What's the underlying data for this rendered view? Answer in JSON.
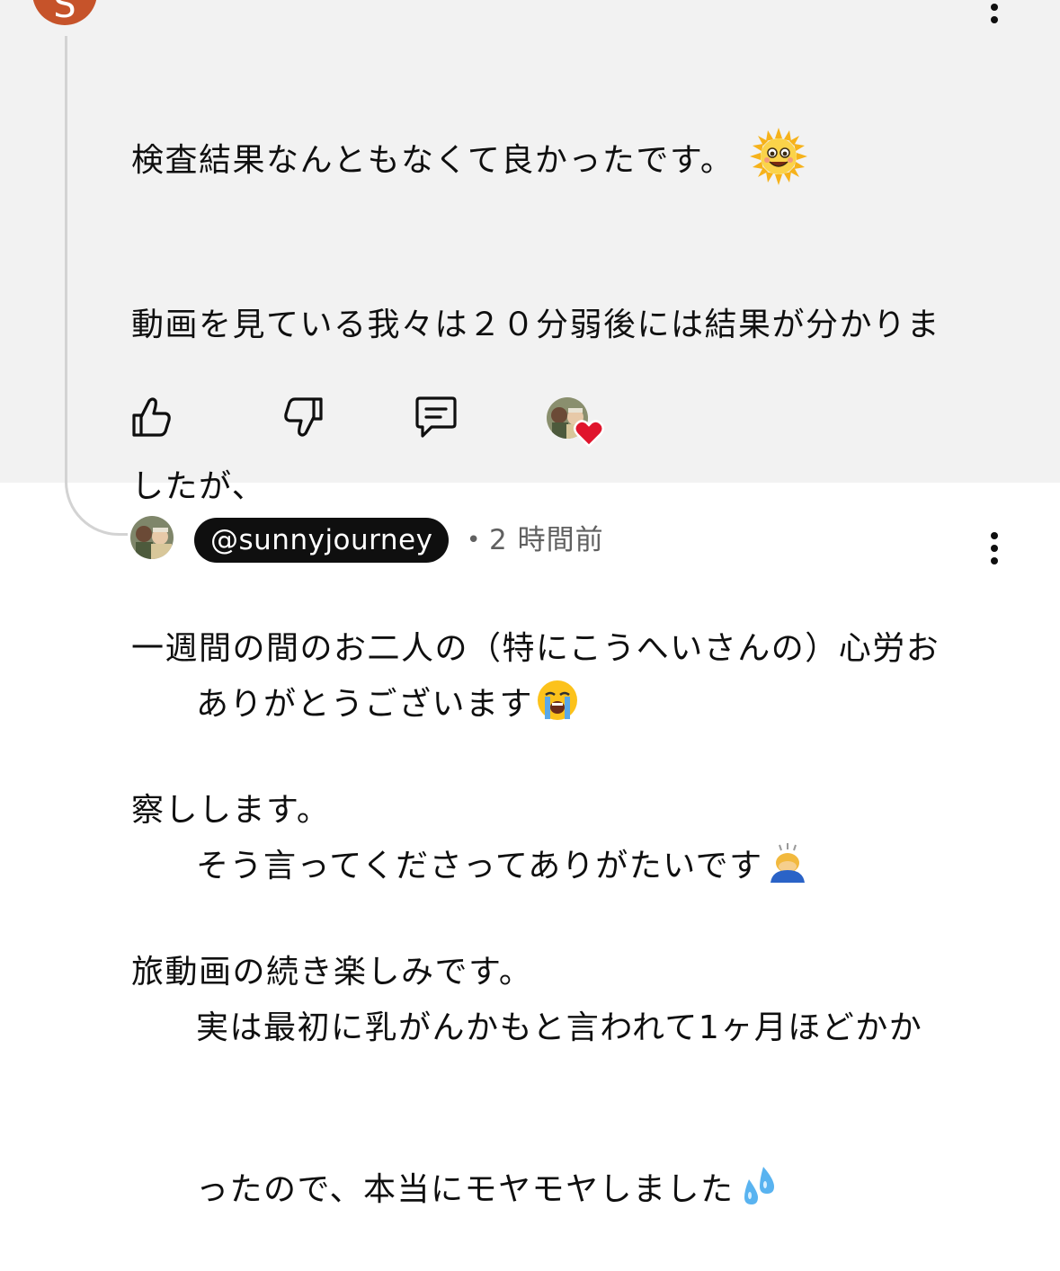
{
  "parent_comment": {
    "avatar_letter": "S",
    "lines": [
      "検査結果なんともなくて良かったです。",
      "動画を見ている我々は２０分弱後には結果が分かりま",
      "したが、",
      "一週間の間のお二人の（特にこうへいさんの）心労お",
      "察しします。",
      "旅動画の続き楽しみです。"
    ]
  },
  "reply": {
    "handle": "@sunnyjourney",
    "separator": "•",
    "timestamp": "2 時間前",
    "lines": [
      "ありがとうございます",
      "そう言ってくださってありがたいです",
      "実は最初に乳がんかもと言われて1ヶ月ほどかか",
      "ったので、本当にモヤモヤしました"
    ]
  },
  "icons": {
    "line1_emoji": "sun-emoji",
    "reply_line1_emoji": "loudly-crying-emoji",
    "reply_line2_emoji": "person-bowing-emoji",
    "reply_line4_emoji": "sweat-droplets-emoji",
    "like": "thumbs-up-icon",
    "dislike": "thumbs-down-icon",
    "reply": "comment-icon",
    "creator_heart": "heart-icon"
  },
  "colors": {
    "top_background": "#f2f2f2",
    "avatar_top": "#c6532a",
    "heart": "#e0152d",
    "handle_pill": "#0f0f0f",
    "meta_text": "#606060"
  }
}
